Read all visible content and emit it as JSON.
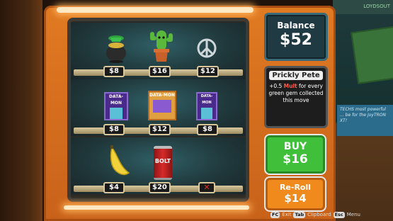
{
  "balance": {
    "label": "Balance",
    "value": "$52"
  },
  "joker": {
    "name": "Prickly Pete",
    "desc_pre": "+0.5 ",
    "desc_mult": "Mult",
    "desc_post": " for every green gem collected this move"
  },
  "buy": {
    "label": "BUY",
    "price": "$16"
  },
  "reroll": {
    "label": "Re-Roll",
    "price": "$14"
  },
  "shelves": [
    {
      "items": [
        {
          "name": "pot-of-gold-icon",
          "price": "$8"
        },
        {
          "name": "cactus-icon",
          "price": "$16"
        },
        {
          "name": "peace-sign-icon",
          "price": "$12"
        }
      ]
    },
    {
      "items": [
        {
          "name": "data-mon-cards-icon",
          "price": "$8"
        },
        {
          "name": "data-mon-box-icon",
          "price": "$12"
        },
        {
          "name": "data-mon-cards-icon",
          "price": "$8"
        }
      ]
    },
    {
      "items": [
        {
          "name": "banana-icon",
          "price": "$4"
        },
        {
          "name": "bolt-can-icon",
          "price": "$20"
        },
        {
          "name": "sold-out-icon",
          "price": "✕"
        }
      ]
    }
  ],
  "item_text": {
    "data_mon": "DATA-MON",
    "bolt": "BOLT"
  },
  "hints": {
    "fc": "FC",
    "exit": "Exit",
    "tab": "Tab",
    "clipboard": "Clipboard",
    "esc": "Esc",
    "menu": "Menu"
  },
  "background": {
    "poster": "TECHS most powerful ... be for the JoyTRON XT!",
    "strip": "LOYDSOUT"
  },
  "colors": {
    "machine": "#e07a22",
    "buy": "#3fbf3a",
    "reroll": "#f08a1c",
    "panel": "#203a44",
    "neon": "#ffe2b0"
  }
}
